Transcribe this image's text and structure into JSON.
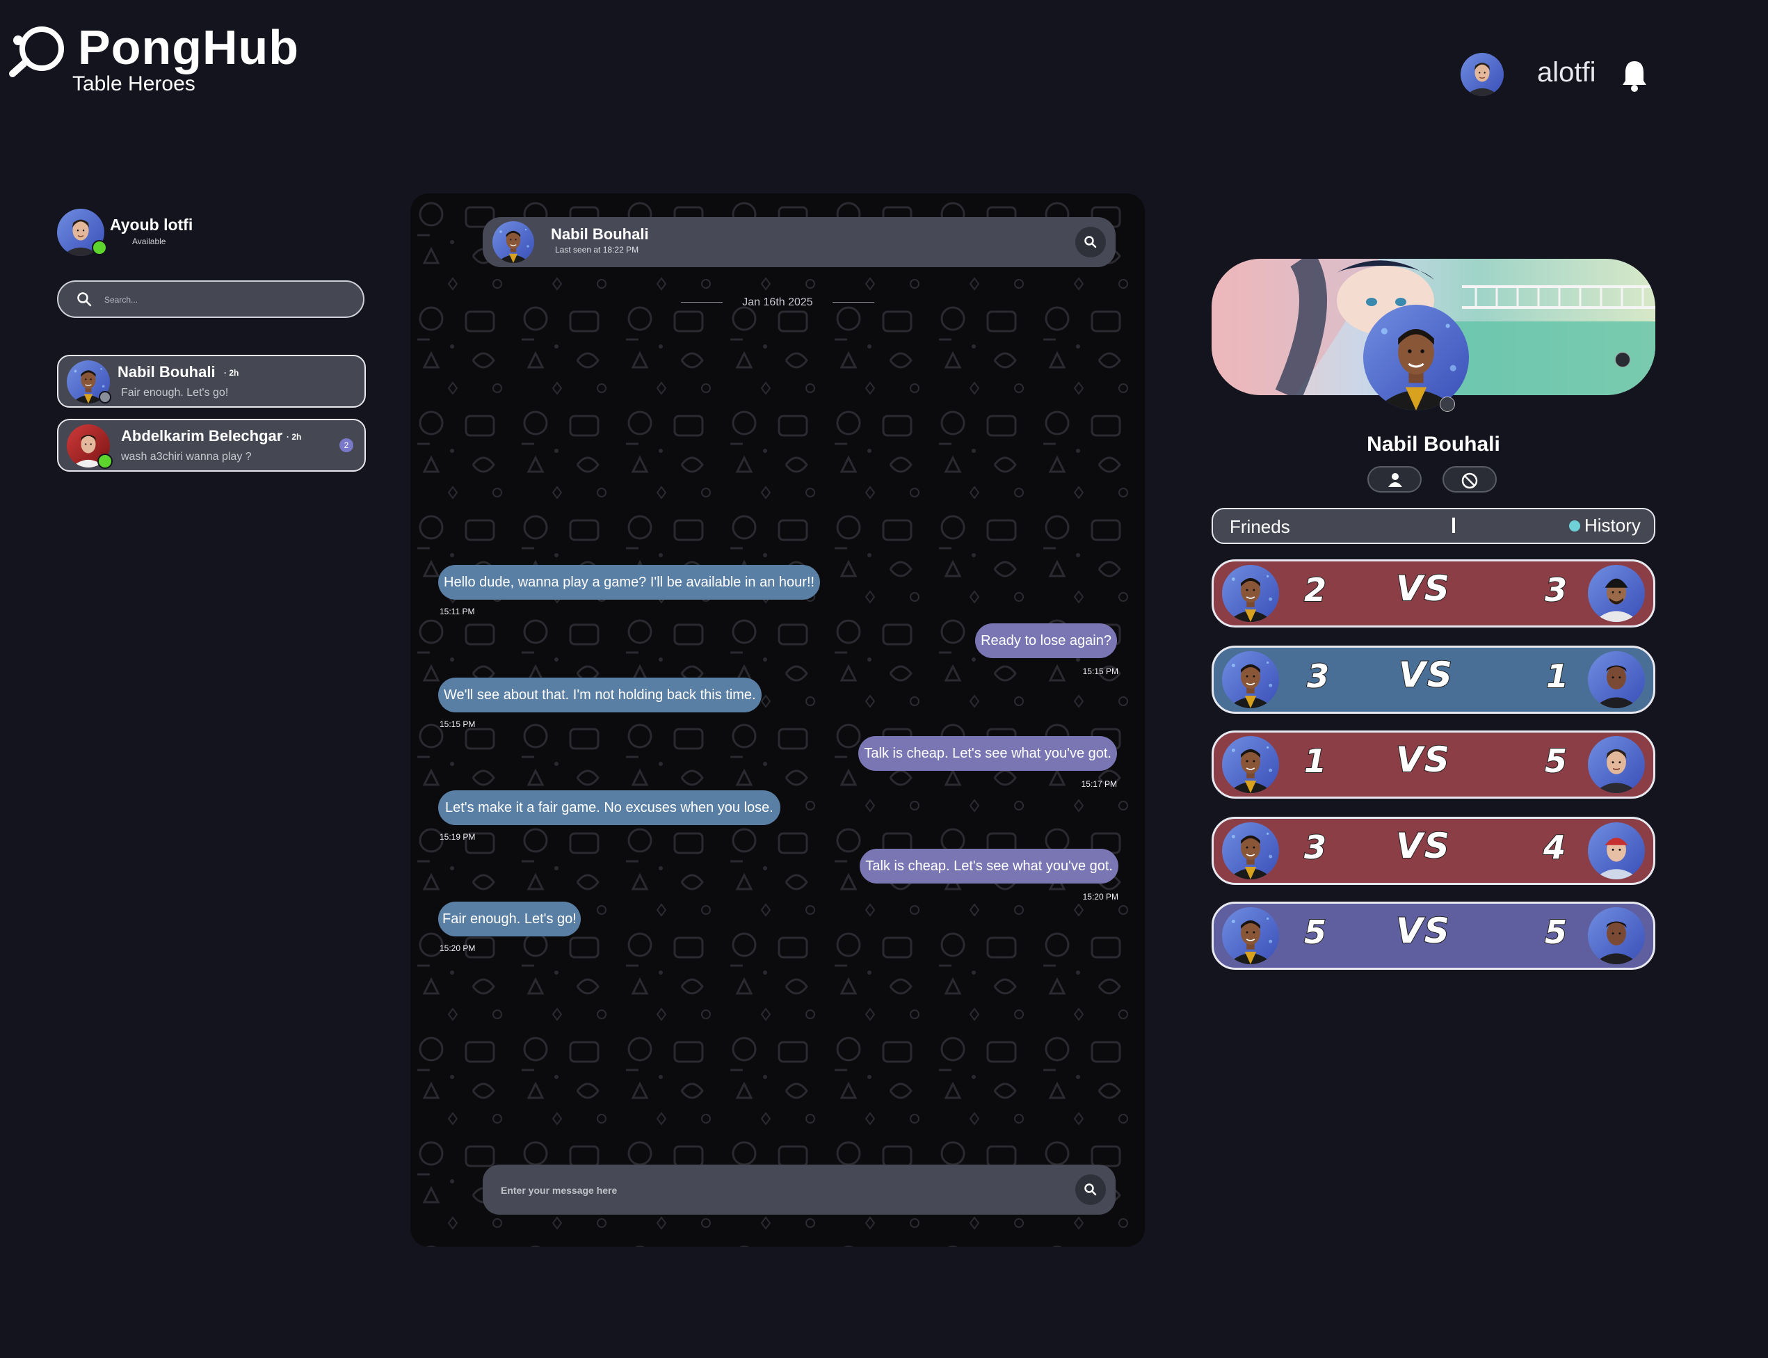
{
  "brand": {
    "name": "PongHub",
    "tagline": "Table Heroes"
  },
  "header": {
    "username": "alotfi",
    "icons": [
      "user-avatar",
      "bell-icon"
    ]
  },
  "me": {
    "name": "Ayoub lotfi",
    "status": "Available"
  },
  "search": {
    "placeholder": "Search..."
  },
  "conversations": [
    {
      "name": "Nabil Bouhali",
      "time": "2h",
      "preview": "Fair enough. Let's go!",
      "unread": ""
    },
    {
      "name": "Abdelkarim Belechgar",
      "time": "2h",
      "preview": "wash a3chiri wanna play ?",
      "unread": "2"
    }
  ],
  "chat": {
    "contact": "Nabil Bouhali",
    "last_seen": "Last seen at 18:22 PM",
    "date": "Jan 16th 2025",
    "messages": [
      {
        "dir": "in",
        "text": "Hello dude, wanna play a game? I'll be available in an hour!!",
        "time": "15:11 PM"
      },
      {
        "dir": "out",
        "text": "Ready to lose again?",
        "time": "15:15 PM"
      },
      {
        "dir": "in",
        "text": "We'll see about that. I'm not holding back this time.",
        "time": "15:15 PM"
      },
      {
        "dir": "out",
        "text": "Talk is cheap. Let's see what you've got.",
        "time": "15:17 PM"
      },
      {
        "dir": "in",
        "text": "Let's make it a fair game. No excuses when you lose.",
        "time": "15:19 PM"
      },
      {
        "dir": "out",
        "text": "Talk is cheap. Let's see what you've got.",
        "time": "15:20 PM"
      },
      {
        "dir": "in",
        "text": "Fair enough. Let's go!",
        "time": "15:20 PM"
      }
    ],
    "input_placeholder": "Enter your message here"
  },
  "profile": {
    "name": "Nabil Bouhali",
    "tabs": {
      "friends": "Frineds",
      "history": "History",
      "active": "history"
    }
  },
  "history": [
    {
      "left": "2",
      "right": "3",
      "vs": "VS",
      "result": "loss"
    },
    {
      "left": "3",
      "right": "1",
      "vs": "VS",
      "result": "win"
    },
    {
      "left": "1",
      "right": "5",
      "vs": "VS",
      "result": "loss"
    },
    {
      "left": "3",
      "right": "4",
      "vs": "VS",
      "result": "loss"
    },
    {
      "left": "5",
      "right": "5",
      "vs": "VS",
      "result": "draw"
    }
  ],
  "colors": {
    "background": "#14141f",
    "panel": "#454752",
    "incoming_bubble": "#5a7fa5",
    "outgoing_bubble": "#7a76b4",
    "loss": "#8b3e46",
    "win": "#4a6f96",
    "draw": "#5f5f9f",
    "online": "#5dd52c"
  }
}
